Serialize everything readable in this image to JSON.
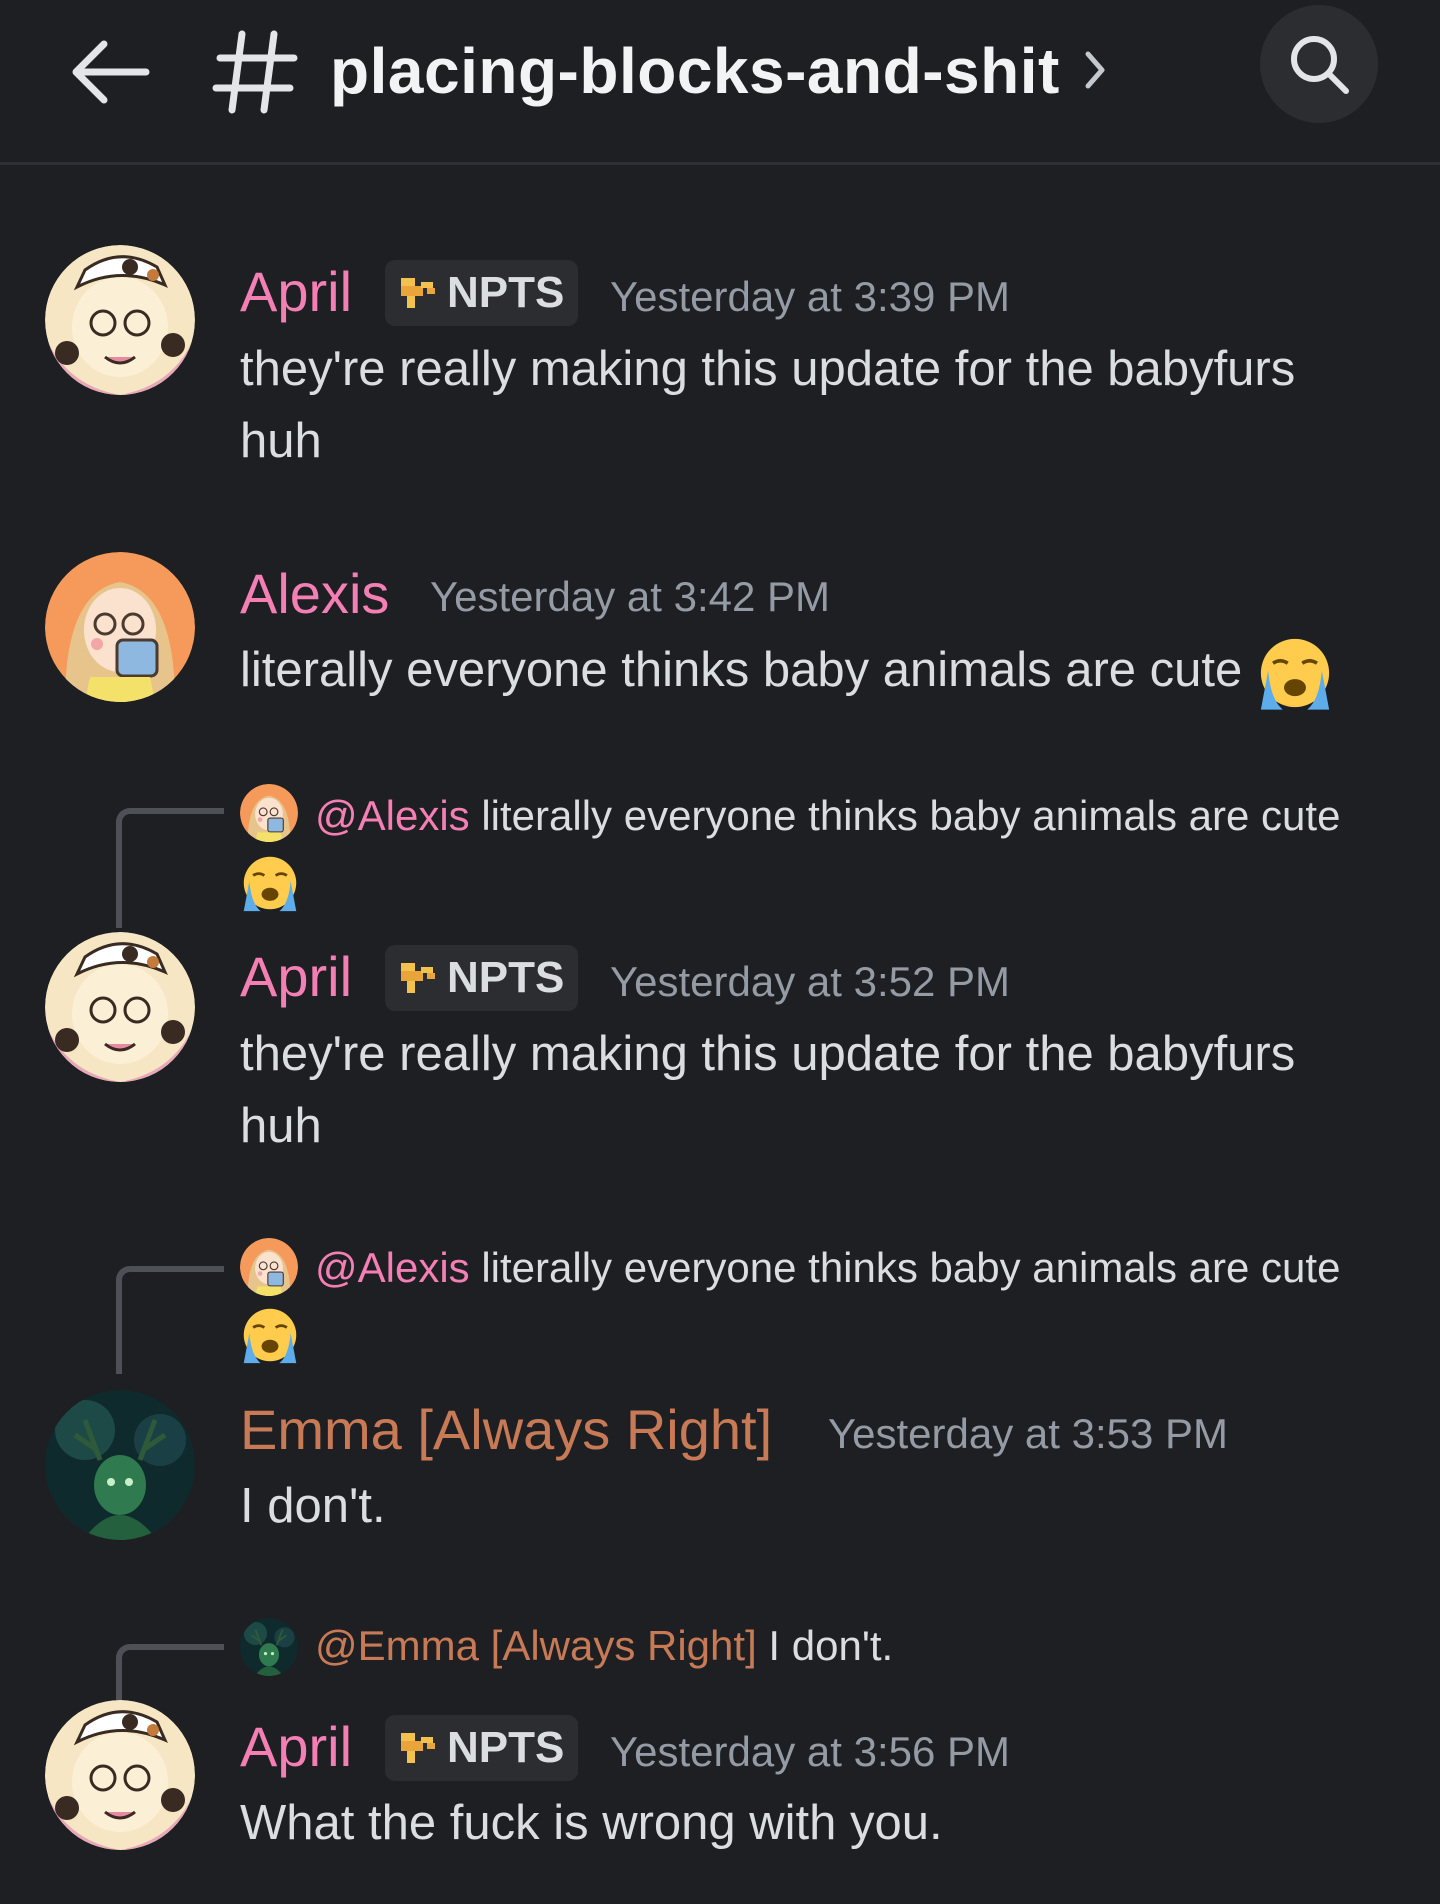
{
  "header": {
    "back_icon": "arrow-left-icon",
    "hash_icon": "hash-icon",
    "channel_name": "placing-blocks-and-shit",
    "chevron_icon": "chevron-right-icon",
    "search_icon": "search-icon"
  },
  "colors": {
    "background": "#1e1f22",
    "april_name": "#f47fb4",
    "alexis_name": "#f47fb4",
    "emma_name": "#c77a55",
    "timestamp": "#949ba4",
    "tag_bg": "#2b2d31"
  },
  "messages": [
    {
      "author": "April",
      "tag": "NPTS",
      "timestamp": "Yesterday at 3:39 PM",
      "text": "they're really making this update for the babyfurs huh"
    },
    {
      "author": "Alexis",
      "timestamp": "Yesterday at 3:42 PM",
      "text": "literally everyone thinks baby animals are cute",
      "emoji": "loudly-crying-face-emoji"
    },
    {
      "reply": {
        "mention": "@Alexis",
        "text": "literally everyone thinks baby animals are cute",
        "emoji": "loudly-crying-face-emoji"
      },
      "author": "April",
      "tag": "NPTS",
      "timestamp": "Yesterday at 3:52 PM",
      "text": "they're really making this update for the babyfurs huh"
    },
    {
      "reply": {
        "mention": "@Alexis",
        "text": "literally everyone thinks baby animals are cute",
        "emoji": "loudly-crying-face-emoji"
      },
      "author": "Emma [Always Right]",
      "timestamp": "Yesterday at 3:53 PM",
      "text": "I don't."
    },
    {
      "reply": {
        "mention": "@Emma [Always Right]",
        "text": "I don't."
      },
      "author": "April",
      "tag": "NPTS",
      "timestamp": "Yesterday at 3:56 PM",
      "text": "What the fuck is wrong with you."
    }
  ]
}
